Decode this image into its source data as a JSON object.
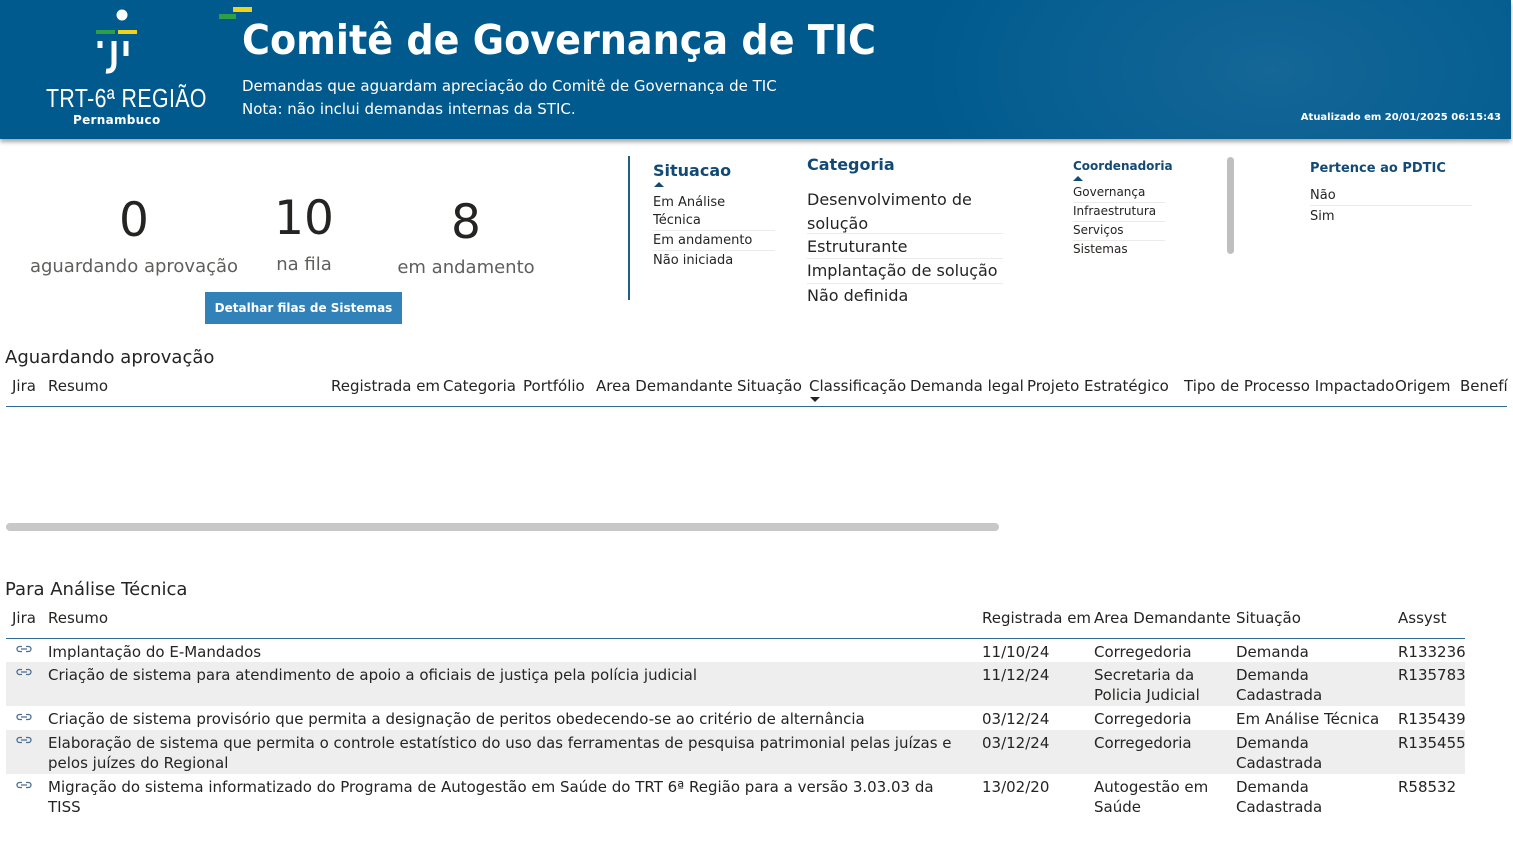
{
  "header": {
    "logo_name": "TRT-6ª REGIÃO",
    "logo_sub": "Pernambuco",
    "title": "Comitê de Governança de TIC",
    "subtitle1": "Demandas que aguardam apreciação do Comitê de Governança de TIC",
    "subtitle2": "Nota: não inclui demandas internas da STIC.",
    "updated": "Atualizado em 20/01/2025 06:15:43",
    "bg_color": "#005a8e"
  },
  "kpis": [
    {
      "value": "0",
      "label": "aguardando aprovação"
    },
    {
      "value": "10",
      "label": "na fila"
    },
    {
      "value": "8",
      "label": "em andamento"
    }
  ],
  "detail_button": "Detalhar filas de Sistemas",
  "slicers": {
    "situacao": {
      "title": "Situacao",
      "items": [
        "Em Análise Técnica",
        "Em andamento",
        "Não iniciada"
      ]
    },
    "categoria": {
      "title": "Categoria",
      "items": [
        "Desenvolvimento de solução",
        "Estruturante",
        "Implantação de solução",
        "Não definida"
      ]
    },
    "coordenadoria": {
      "title": "Coordenadoria",
      "items": [
        "Governança",
        "Infraestrutura",
        "Serviços",
        "Sistemas"
      ]
    },
    "pdtic": {
      "title": "Pertence ao PDTIC",
      "items": [
        "Não",
        "Sim"
      ]
    }
  },
  "table1": {
    "title": "Aguardando aprovação",
    "columns": [
      "Jira",
      "Resumo",
      "Registrada em",
      "Categoria",
      "Portfólio",
      "Area Demandante",
      "Situação",
      "Classificação",
      "Demanda legal",
      "Projeto Estratégico",
      "Tipo de Processo Impactado",
      "Origem",
      "Benefí"
    ],
    "rows": []
  },
  "table2": {
    "title": "Para Análise Técnica",
    "columns": [
      "Jira",
      "Resumo",
      "Registrada em",
      "Area Demandante",
      "Situação",
      "Assyst"
    ],
    "rows": [
      {
        "resumo": "Implantação do E-Mandados",
        "registrada": "11/10/24",
        "area": "Corregedoria",
        "situacao": "Demanda Cadastrada",
        "assyst": "R133236"
      },
      {
        "resumo": "Criação de sistema para atendimento de apoio a oficiais de justiça pela polícia judicial",
        "registrada": "11/12/24",
        "area": "Secretaria da Policia Judicial",
        "situacao": "Demanda Cadastrada",
        "assyst": "R135783"
      },
      {
        "resumo": "Criação de sistema provisório que permita a designação de peritos obedecendo-se ao critério de alternância",
        "registrada": "03/12/24",
        "area": "Corregedoria",
        "situacao": "Em Análise Técnica",
        "assyst": "R135439"
      },
      {
        "resumo": "Elaboração de sistema que permita o controle estatístico do uso das ferramentas de pesquisa patrimonial pelas juízas e pelos juízes do Regional",
        "registrada": "03/12/24",
        "area": "Corregedoria",
        "situacao": "Demanda Cadastrada",
        "assyst": "R135455"
      },
      {
        "resumo": "Migração do sistema informatizado do Programa de Autogestão em Saúde do TRT 6ª Região para a versão 3.03.03 da TISS",
        "registrada": "13/02/20",
        "area": "Autogestão em Saúde",
        "situacao": "Demanda Cadastrada",
        "assyst": "R58532"
      }
    ]
  }
}
